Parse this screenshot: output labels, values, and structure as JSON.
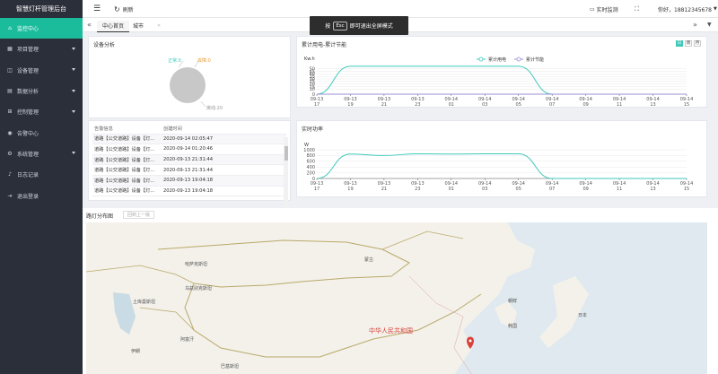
{
  "brand": {
    "title": "智慧灯杆管理后台"
  },
  "sidebar": {
    "items": [
      {
        "label": "监控中心",
        "icon": "home-icon",
        "active": true,
        "expandable": false
      },
      {
        "label": "项目管理",
        "icon": "grid-icon",
        "active": false,
        "expandable": true
      },
      {
        "label": "设备管理",
        "icon": "device-icon",
        "active": false,
        "expandable": true
      },
      {
        "label": "数据分析",
        "icon": "chart-icon",
        "active": false,
        "expandable": true
      },
      {
        "label": "控制管理",
        "icon": "control-icon",
        "active": false,
        "expandable": true
      },
      {
        "label": "告警中心",
        "icon": "alarm-icon",
        "active": false,
        "expandable": false
      },
      {
        "label": "系统管理",
        "icon": "gear-icon",
        "active": false,
        "expandable": true
      },
      {
        "label": "日志记录",
        "icon": "bell-icon",
        "active": false,
        "expandable": false
      },
      {
        "label": "退出登录",
        "icon": "logout-icon",
        "active": false,
        "expandable": false
      }
    ]
  },
  "topbar": {
    "refresh_label": "刷新",
    "monitor_label": "实时监测",
    "user_label": "你好，18812345678"
  },
  "fullscreen_hint": {
    "prefix": "按",
    "key": "Esc",
    "suffix": "即可退出全屏模式"
  },
  "tabs": {
    "items": [
      "中心首页",
      "城市"
    ]
  },
  "device_panel": {
    "title": "设备分析",
    "legend_normal": "正常:0",
    "legend_fault": "故障:0",
    "legend_offline": "离线:20"
  },
  "energy_panel": {
    "title": "累计用电-累计节能",
    "unit": "Kw.h",
    "legend": [
      "累计用电",
      "累计节能"
    ],
    "buttons": [
      "日",
      "周",
      "月"
    ]
  },
  "alarm_panel": {
    "headers": [
      "告警信息",
      "创建时间"
    ],
    "rows": [
      [
        "道路【公交道路】设备【灯...",
        "2020-09-14 02:05:47"
      ],
      [
        "道路【公交道路】设备【灯...",
        "2020-09-14 01:20:46"
      ],
      [
        "道路【公交道路】设备【灯...",
        "2020-09-13 21:31:44"
      ],
      [
        "道路【公交道路】设备【灯...",
        "2020-09-13 21:31:44"
      ],
      [
        "道路【公交道路】设备【灯...",
        "2020-09-13 19:04:18"
      ],
      [
        "道路【公交道路】设备【灯...",
        "2020-09-13 19:04:18"
      ]
    ]
  },
  "power_panel": {
    "title": "实时功率",
    "unit": "W"
  },
  "map_panel": {
    "title": "路灯分布图",
    "back_button": "回到上一级",
    "labels": [
      "蒙古",
      "哈萨克斯坦",
      "乌兹别克斯坦",
      "土库曼斯坦",
      "阿富汗",
      "伊朗",
      "巴基斯坦",
      "中华人民共和国",
      "朝鲜",
      "韩国",
      "日本"
    ]
  },
  "chart_data": [
    {
      "type": "line",
      "title": "累计用电-累计节能",
      "ylabel": "Kw.h",
      "ylim": [
        0,
        60
      ],
      "yticks": [
        0,
        10,
        15,
        20,
        25,
        30,
        35,
        40,
        45,
        50
      ],
      "x": [
        "09-13 17",
        "09-13 19",
        "09-13 21",
        "09-13 23",
        "09-14 01",
        "09-14 03",
        "09-14 05",
        "09-14 07",
        "09-14 09",
        "09-14 11",
        "09-14 13",
        "09-14 15"
      ],
      "series": [
        {
          "name": "累计用电",
          "color": "#3ec9b8",
          "values": [
            0,
            55,
            55,
            55,
            55,
            55,
            55,
            0,
            0,
            0,
            0,
            0
          ]
        },
        {
          "name": "累计节能",
          "color": "#9b8fd6",
          "values": [
            0,
            0,
            0,
            0,
            0,
            0,
            0,
            0,
            0,
            0,
            0,
            0
          ]
        }
      ],
      "legend": "top-right"
    },
    {
      "type": "line",
      "title": "实时功率",
      "ylabel": "W",
      "ylim": [
        0,
        1000
      ],
      "yticks": [
        0,
        200,
        400,
        600,
        800,
        1000
      ],
      "x": [
        "09-13 17",
        "09-13 19",
        "09-13 21",
        "09-13 23",
        "09-14 01",
        "09-14 03",
        "09-14 05",
        "09-14 07",
        "09-14 09",
        "09-14 11",
        "09-14 13",
        "09-14 15"
      ],
      "series": [
        {
          "name": "",
          "color": "#3ec9b8",
          "values": [
            0,
            850,
            800,
            860,
            850,
            860,
            860,
            0,
            0,
            0,
            0,
            0
          ]
        }
      ]
    }
  ]
}
